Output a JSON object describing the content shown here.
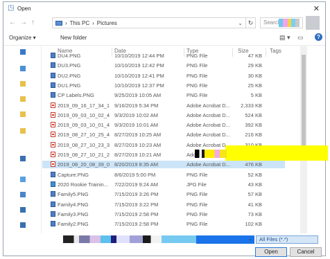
{
  "window": {
    "title": "Open",
    "close_label": "✕"
  },
  "address": {
    "back": "←",
    "forward": "→",
    "up": "↑",
    "path": [
      "This PC",
      "Pictures"
    ],
    "separator": "›",
    "dropdown": "⌄",
    "refresh": "↻",
    "search_placeholder": "Search Pi"
  },
  "toolbar": {
    "organize": "Organize ▾",
    "new_folder": "New folder",
    "view_icon": "▤ ▾",
    "pane_icon": "▭"
  },
  "columns": {
    "name": "Name",
    "date": "Date",
    "type": "Type",
    "size": "Size",
    "tags": "Tags"
  },
  "files": [
    {
      "name": "DU4.PNG",
      "date": "10/10/2019 12:44 PM",
      "type": "PNG File",
      "size": "47 KB",
      "icon": "png"
    },
    {
      "name": "DU3.PNG",
      "date": "10/10/2019 12:42 PM",
      "type": "PNG File",
      "size": "29 KB",
      "icon": "png"
    },
    {
      "name": "DU2.PNG",
      "date": "10/10/2019 12:41 PM",
      "type": "PNG File",
      "size": "30 KB",
      "icon": "png"
    },
    {
      "name": "DU1.PNG",
      "date": "10/10/2019 12:37 PM",
      "type": "PNG File",
      "size": "25 KB",
      "icon": "png"
    },
    {
      "name": "CP Labels.PNG",
      "date": "9/25/2019 10:05 AM",
      "type": "PNG File",
      "size": "5 KB",
      "icon": "png"
    },
    {
      "name": "2019_09_16_17_34_1...",
      "date": "9/16/2019 5:34 PM",
      "type": "Adobe Acrobat D...",
      "size": "2,333 KB",
      "icon": "pdf"
    },
    {
      "name": "2019_09_03_10_02_4...",
      "date": "9/3/2019 10:02 AM",
      "type": "Adobe Acrobat D...",
      "size": "524 KB",
      "icon": "pdf"
    },
    {
      "name": "2019_09_03_10_01_4...",
      "date": "9/3/2019 10:01 AM",
      "type": "Adobe Acrobat D...",
      "size": "392 KB",
      "icon": "pdf"
    },
    {
      "name": "2019_08_27_10_25_4...",
      "date": "8/27/2019 10:25 AM",
      "type": "Adobe Acrobat D...",
      "size": "216 KB",
      "icon": "pdf"
    },
    {
      "name": "2019_08_27_10_23_3...",
      "date": "8/27/2019 10:23 AM",
      "type": "Adobe Acrobat D...",
      "size": "310 KB",
      "icon": "pdf"
    },
    {
      "name": "2019_08_27_10_21_2...",
      "date": "8/27/2019 10:21 AM",
      "type": "Adobe Acrobat D...",
      "size": "",
      "icon": "pdf"
    },
    {
      "name": "2019_08_20_08_39_0...",
      "date": "8/20/2019 8:35 AM",
      "type": "Adobe Acrobat D...",
      "size": "476 KB",
      "icon": "pdf",
      "selected": true
    },
    {
      "name": "Capture.PNG",
      "date": "8/6/2019 5:00 PM",
      "type": "PNG File",
      "size": "52 KB",
      "icon": "png"
    },
    {
      "name": "2020 Rookie Trainin...",
      "date": "7/22/2019 9:24 AM",
      "type": "JPG File",
      "size": "43 KB",
      "icon": "jpg"
    },
    {
      "name": "Family5.PNG",
      "date": "7/15/2019 3:26 PM",
      "type": "PNG File",
      "size": "57 KB",
      "icon": "png"
    },
    {
      "name": "Family4.PNG",
      "date": "7/15/2019 3:22 PM",
      "type": "PNG File",
      "size": "41 KB",
      "icon": "png"
    },
    {
      "name": "Family3.PNG",
      "date": "7/15/2019 2:58 PM",
      "type": "PNG File",
      "size": "73 KB",
      "icon": "png"
    },
    {
      "name": "Family2.PNG",
      "date": "7/15/2019 2:58 PM",
      "type": "PNG File",
      "size": "102 KB",
      "icon": "png"
    }
  ],
  "footer": {
    "file_type": "All Files (*.*)",
    "type_dropdown": "⌄",
    "open": "Open",
    "cancel": "Cancel"
  },
  "colors": {
    "selection": "#cce4f7",
    "accent": "#1a73e8",
    "pdf_red": "#c0392b",
    "png_blue": "#4e7fc4"
  }
}
